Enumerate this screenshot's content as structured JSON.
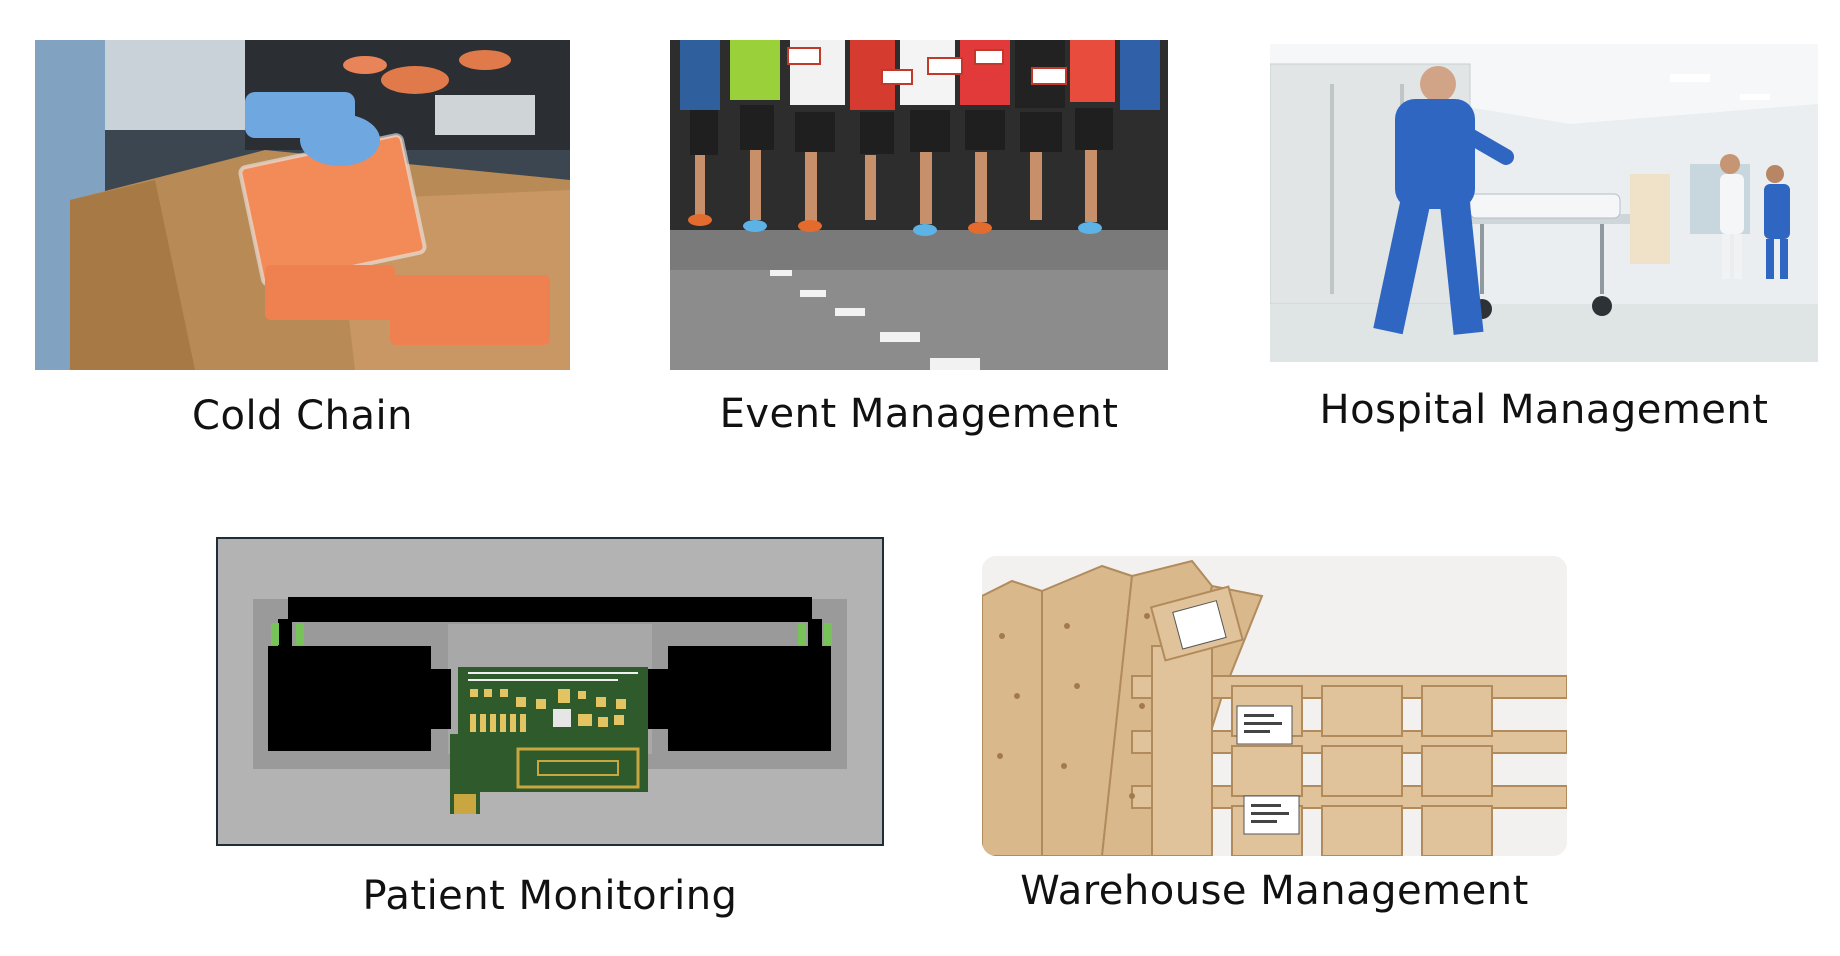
{
  "tiles": [
    {
      "caption": "Cold Chain",
      "image": "packed-salmon-in-box"
    },
    {
      "caption": "Event Management",
      "image": "marathon-runners"
    },
    {
      "caption": "Hospital Management",
      "image": "hospital-corridor-nurse"
    },
    {
      "caption": "Patient Monitoring",
      "image": "circuit-board-device"
    },
    {
      "caption": "Warehouse Management",
      "image": "wooden-pallets"
    }
  ],
  "colors": {
    "caption_text": "#111111",
    "patient_border": "#1f2d3a",
    "pcb_green": "#2d5a2a",
    "pcb_gold": "#c9a640"
  }
}
